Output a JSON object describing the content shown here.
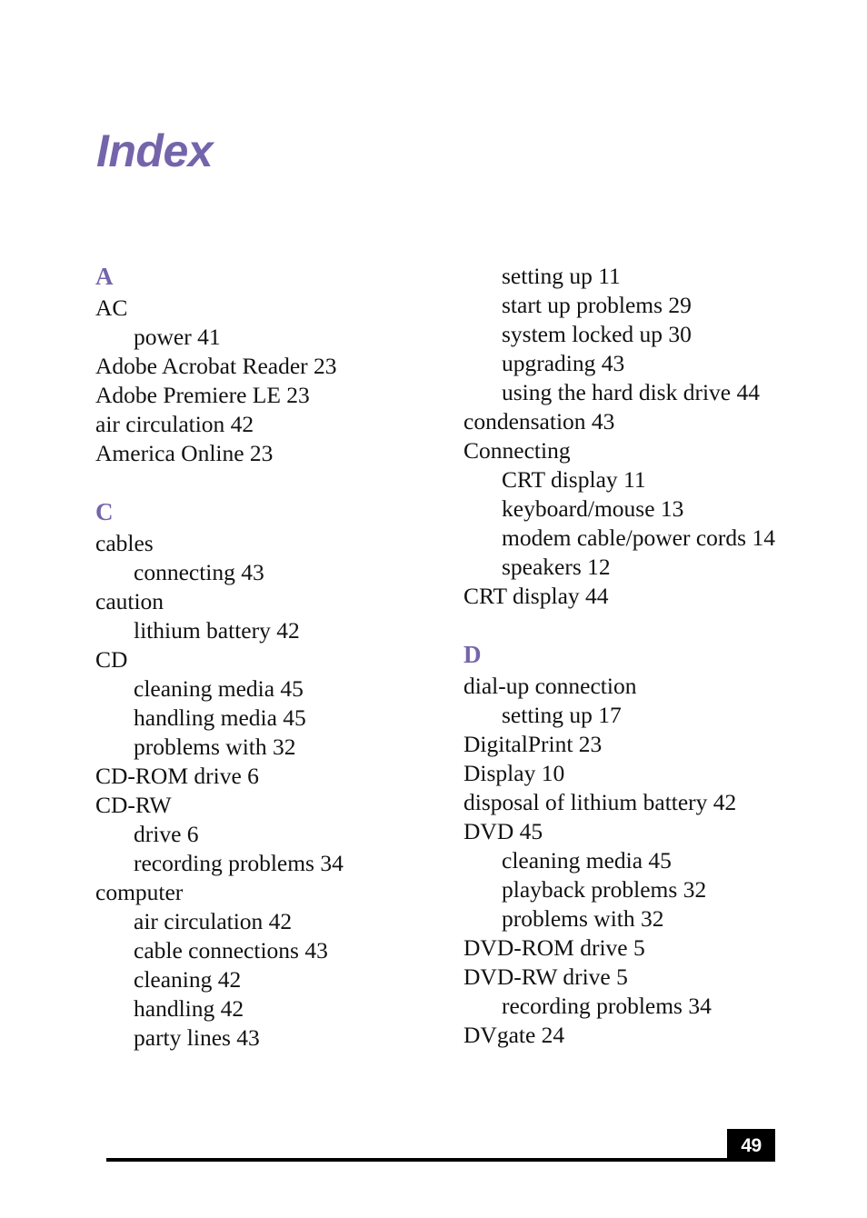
{
  "document": {
    "title": "Index",
    "title_color": "#7465ab",
    "text_color": "#121212",
    "page_number": "49"
  },
  "columns": {
    "left": [
      {
        "letter": "A",
        "entries": [
          {
            "text": "AC",
            "level": 0
          },
          {
            "text": "power 41",
            "level": 1
          },
          {
            "text": "Adobe Acrobat Reader 23",
            "level": 0
          },
          {
            "text": "Adobe Premiere LE 23",
            "level": 0
          },
          {
            "text": "air circulation 42",
            "level": 0
          },
          {
            "text": "America Online 23",
            "level": 0
          }
        ]
      },
      {
        "letter": "C",
        "entries": [
          {
            "text": "cables",
            "level": 0
          },
          {
            "text": "connecting 43",
            "level": 1
          },
          {
            "text": "caution",
            "level": 0
          },
          {
            "text": "lithium battery 42",
            "level": 1
          },
          {
            "text": "CD",
            "level": 0
          },
          {
            "text": "cleaning media 45",
            "level": 1
          },
          {
            "text": "handling media 45",
            "level": 1
          },
          {
            "text": "problems with 32",
            "level": 1
          },
          {
            "text": "CD-ROM drive 6",
            "level": 0
          },
          {
            "text": "CD-RW",
            "level": 0
          },
          {
            "text": "drive 6",
            "level": 1
          },
          {
            "text": "recording problems 34",
            "level": 1
          },
          {
            "text": "computer",
            "level": 0
          },
          {
            "text": "air circulation 42",
            "level": 1
          },
          {
            "text": "cable connections 43",
            "level": 1
          },
          {
            "text": "cleaning 42",
            "level": 1
          },
          {
            "text": "handling 42",
            "level": 1
          },
          {
            "text": "party lines 43",
            "level": 1
          }
        ]
      }
    ],
    "right": [
      {
        "letter": "",
        "entries": [
          {
            "text": "setting up 11",
            "level": 1
          },
          {
            "text": "start up problems 29",
            "level": 1
          },
          {
            "text": "system locked up 30",
            "level": 1
          },
          {
            "text": "upgrading 43",
            "level": 1
          },
          {
            "text": "using the hard disk drive 44",
            "level": 1
          },
          {
            "text": "condensation 43",
            "level": 0
          },
          {
            "text": "Connecting",
            "level": 0
          },
          {
            "text": "CRT display 11",
            "level": 1
          },
          {
            "text": "keyboard/mouse 13",
            "level": 1
          },
          {
            "text": "modem cable/power cords 14",
            "level": 1
          },
          {
            "text": "speakers 12",
            "level": 1
          },
          {
            "text": "CRT display 44",
            "level": 0
          }
        ]
      },
      {
        "letter": "D",
        "entries": [
          {
            "text": "dial-up connection",
            "level": 0
          },
          {
            "text": "setting up 17",
            "level": 1
          },
          {
            "text": "DigitalPrint 23",
            "level": 0
          },
          {
            "text": "Display 10",
            "level": 0
          },
          {
            "text": "disposal of lithium battery 42",
            "level": 0
          },
          {
            "text": "DVD 45",
            "level": 0
          },
          {
            "text": "cleaning media 45",
            "level": 1
          },
          {
            "text": "playback problems 32",
            "level": 1
          },
          {
            "text": "problems with 32",
            "level": 1
          },
          {
            "text": "DVD-ROM drive 5",
            "level": 0
          },
          {
            "text": "DVD-RW drive 5",
            "level": 0
          },
          {
            "text": "recording problems 34",
            "level": 1
          },
          {
            "text": "DVgate 24",
            "level": 0
          }
        ]
      }
    ]
  }
}
